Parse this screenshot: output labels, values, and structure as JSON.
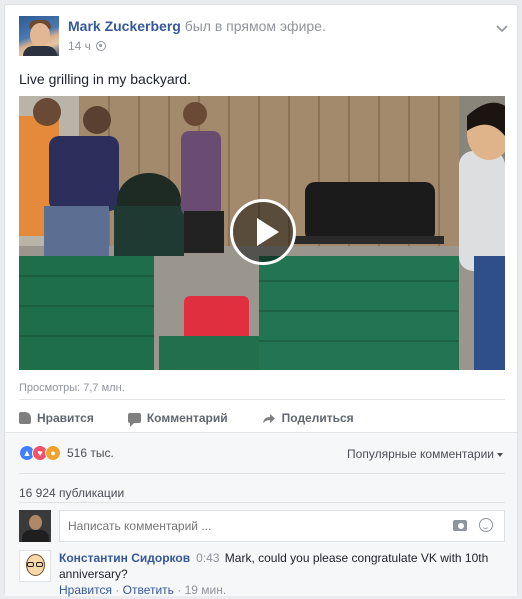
{
  "post": {
    "author": "Mark Zuckerberg",
    "action": "был в прямом эфире.",
    "time": "14 ч",
    "text": "Live grilling in my backyard.",
    "views": "Просмотры: 7,7 млн."
  },
  "actions": {
    "like": "Нравится",
    "comment": "Комментарий",
    "share": "Поделиться"
  },
  "reactions": {
    "count": "516 тыс.",
    "sort_label": "Популярные комментарии"
  },
  "shares": "16 924 публикации",
  "composer": {
    "placeholder": "Написать комментарий ..."
  },
  "comment": {
    "author": "Константин Сидорков",
    "time": "0:43",
    "text": "Mark, could you please congratulate VK with 10th anniversary?",
    "like": "Нравится",
    "reply": "Ответить",
    "separator": "·",
    "ago": "19 мин."
  },
  "colors": {
    "link": "#365899",
    "muted": "#90949c",
    "background": "#e9ebee"
  }
}
